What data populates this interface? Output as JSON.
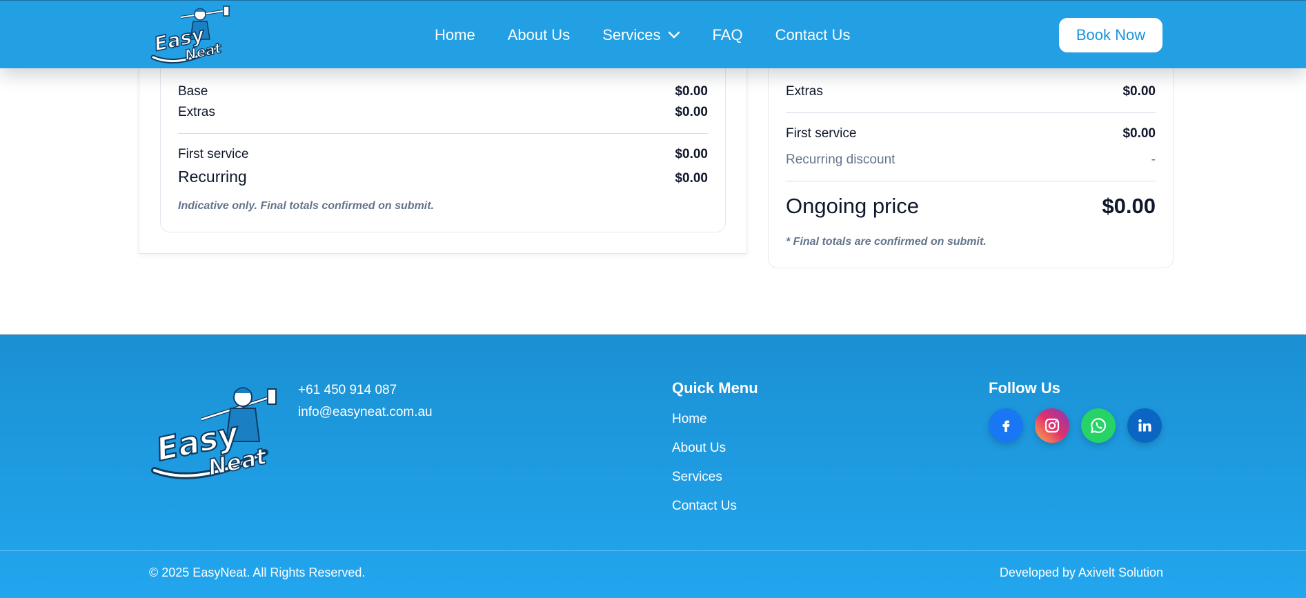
{
  "brand": {
    "logo_line1": "Easy",
    "logo_line2": "Neat"
  },
  "nav": {
    "items": [
      {
        "label": "Home"
      },
      {
        "label": "About Us"
      },
      {
        "label": "Services",
        "has_dropdown": true
      },
      {
        "label": "FAQ"
      },
      {
        "label": "Contact Us"
      }
    ],
    "cta_label": "Book Now"
  },
  "left_summary": {
    "base_label": "Base",
    "base_value": "$0.00",
    "extras_label": "Extras",
    "extras_value": "$0.00",
    "first_service_label": "First service",
    "first_service_value": "$0.00",
    "recurring_label": "Recurring",
    "recurring_value": "$0.00",
    "note": "Indicative only. Final totals confirmed on submit."
  },
  "right_summary": {
    "extras_label": "Extras",
    "extras_value": "$0.00",
    "first_service_label": "First service",
    "first_service_value": "$0.00",
    "recurring_discount_label": "Recurring discount",
    "recurring_discount_value": "-",
    "ongoing_label": "Ongoing price",
    "ongoing_value": "$0.00",
    "note": "* Final totals are confirmed on submit."
  },
  "footer": {
    "phone": "+61 450 914 087",
    "email": "info@easyneat.com.au",
    "quick_menu_title": "Quick Menu",
    "quick_menu": [
      {
        "label": "Home"
      },
      {
        "label": "About Us"
      },
      {
        "label": "Services"
      },
      {
        "label": "Contact Us"
      }
    ],
    "follow_title": "Follow Us",
    "social": [
      {
        "name": "facebook-icon",
        "color": "#1877f2"
      },
      {
        "name": "instagram-icon",
        "color": "#d6249f"
      },
      {
        "name": "whatsapp-icon",
        "color": "#25d366"
      },
      {
        "name": "linkedin-icon",
        "color": "#0a66c2"
      }
    ],
    "copyright": "© 2025 EasyNeat. All Rights Reserved.",
    "developer": "Developed by Axivelt Solution"
  },
  "colors": {
    "primary": "#22a0e3",
    "footer_top": "#1b90d3",
    "footer_bottom": "#22a6ee",
    "text_dark": "#0f172a",
    "text_muted": "#64748b"
  }
}
